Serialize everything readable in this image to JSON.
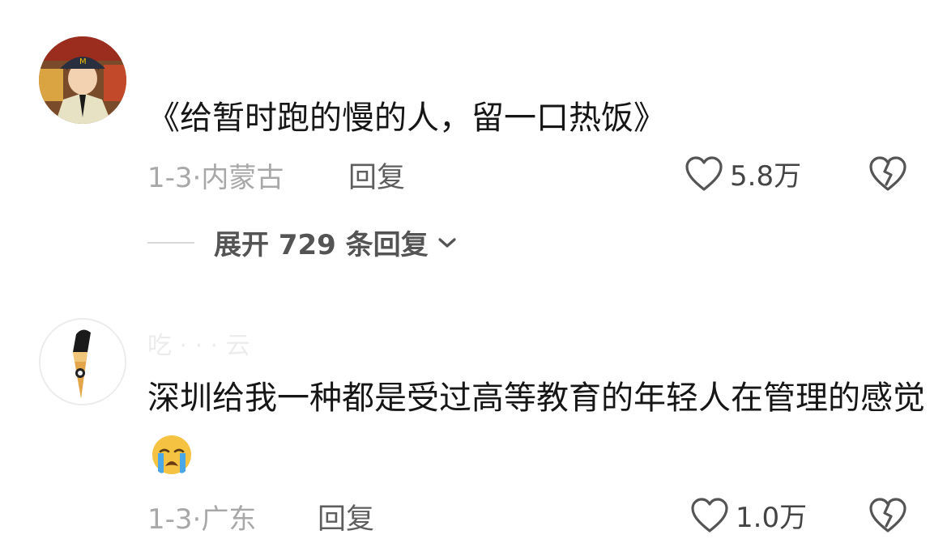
{
  "comments": [
    {
      "username": "",
      "text": "《给暂时跑的慢的人，留一口热饭》",
      "emoji": "",
      "date": "1-3",
      "separator": "·",
      "location": "内蒙古",
      "reply_label": "回复",
      "likes": "5.8万",
      "expand_replies": "展开 729 条回复"
    },
    {
      "username": "吃 ·  ·  · 云",
      "text": "深圳给我一种都是受过高等教育的年轻人在管理的感觉",
      "emoji": "loudly-crying-face",
      "date": "1-3",
      "separator": "·",
      "location": "广东",
      "reply_label": "回复",
      "likes": "1.0万"
    }
  ],
  "icons": {
    "like": "heart-outline-icon",
    "dislike": "broken-heart-icon",
    "expand": "chevron-down-icon"
  },
  "colors": {
    "text": "#161616",
    "meta": "#a8a8a8",
    "reply": "#5e5e5e",
    "like_count": "#444444",
    "emoji_face": "#f5c242",
    "emoji_tear": "#4aa8e8"
  }
}
